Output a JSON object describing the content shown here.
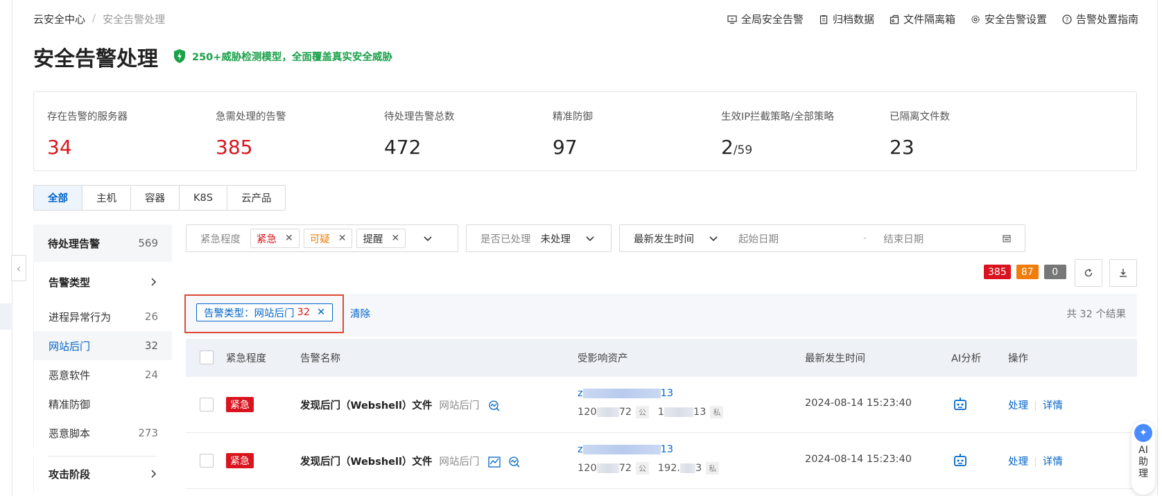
{
  "breadcrumb": {
    "root": "云安全中心",
    "separator": "/",
    "current": "安全告警处理"
  },
  "top_links": [
    {
      "label": "全局安全告警",
      "icon": "monitor-icon"
    },
    {
      "label": "归档数据",
      "icon": "clipboard-icon"
    },
    {
      "label": "文件隔离箱",
      "icon": "box-icon"
    },
    {
      "label": "安全告警设置",
      "icon": "gear-icon"
    },
    {
      "label": "告警处置指南",
      "icon": "question-icon"
    }
  ],
  "page_title": "安全告警处理",
  "tagline": "250+威胁检测模型，全面覆盖真实安全威胁",
  "stats": [
    {
      "label": "存在告警的服务器",
      "value": "34",
      "color": "#d9141e"
    },
    {
      "label": "急需处理的告警",
      "value": "385",
      "color": "#d9141e"
    },
    {
      "label": "待处理告警总数",
      "value": "472"
    },
    {
      "label": "精准防御",
      "value": "97"
    },
    {
      "label": "生效IP拦截策略/全部策略",
      "value": "2",
      "suffix": "/59"
    },
    {
      "label": "已隔离文件数",
      "value": "23"
    }
  ],
  "type_tabs": [
    "全部",
    "主机",
    "容器",
    "K8S",
    "云产品"
  ],
  "sidebar": {
    "head": {
      "label": "待处理告警",
      "count": "569"
    },
    "group1": "告警类型",
    "items": [
      {
        "label": "进程异常行为",
        "count": "26"
      },
      {
        "label": "网站后门",
        "count": "32"
      },
      {
        "label": "恶意软件",
        "count": "24"
      },
      {
        "label": "精准防御",
        "count": ""
      },
      {
        "label": "恶意脚本",
        "count": "273"
      }
    ],
    "group2": "攻击阶段"
  },
  "filters": {
    "severity_label": "紧急程度",
    "severity_chips": [
      {
        "label": "紧急",
        "color": "#d9141e"
      },
      {
        "label": "可疑",
        "color": "#f07c0c"
      },
      {
        "label": "提醒",
        "color": "#333333"
      }
    ],
    "handled_label": "是否已处理",
    "handled_value": "未处理",
    "time_select": "最新发生时间",
    "start_date": "起始日期",
    "date_sep": "-",
    "end_date": "结束日期"
  },
  "count_badges": [
    {
      "value": "385",
      "color": "#d9141e"
    },
    {
      "value": "87",
      "color": "#f07c0c"
    },
    {
      "value": "0",
      "color": "#777777"
    }
  ],
  "selection": {
    "chip_prefix": "告警类型：网站后门",
    "chip_count": "32",
    "clear": "清除",
    "result_count": "共 32 个结果"
  },
  "table": {
    "columns": [
      "紧急程度",
      "告警名称",
      "受影响资产",
      "最新发生时间",
      "AI分析",
      "操作"
    ],
    "rows": [
      {
        "severity": "紧急",
        "name": "发现后门（Webshell）文件",
        "type": "网站后门",
        "asset_line1_prefix": "z",
        "asset_line1_suffix": "13",
        "ip_public_prefix": "120",
        "ip_public_suffix": "72",
        "public_tag": "公",
        "ip_private_prefix": "1",
        "ip_private_suffix": "13",
        "private_tag": "私",
        "time": "2024-08-14 15:23:40",
        "op_handle": "处理",
        "op_detail": "详情"
      },
      {
        "severity": "紧急",
        "name": "发现后门（Webshell）文件",
        "type": "网站后门",
        "asset_line1_prefix": "z",
        "asset_line1_suffix": "13",
        "ip_public_prefix": "120",
        "ip_public_suffix": "72",
        "public_tag": "公",
        "ip_private_prefix": "192.",
        "ip_private_suffix": "3",
        "private_tag": "私",
        "time": "2024-08-14 15:23:40",
        "op_handle": "处理",
        "op_detail": "详情"
      }
    ]
  },
  "ai_assistant": {
    "line1": "AI",
    "line2": "助",
    "line3": "理"
  }
}
